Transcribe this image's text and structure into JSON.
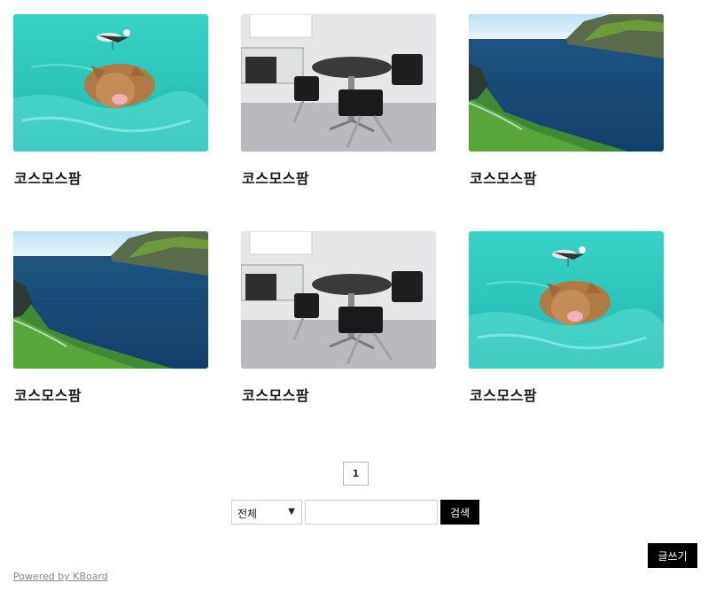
{
  "posts": [
    {
      "title": "코스모스팜",
      "image": "pig-swimming-photo"
    },
    {
      "title": "코스모스팜",
      "image": "office-meeting-room-photo"
    },
    {
      "title": "코스모스팜",
      "image": "sea-cliff-photo"
    },
    {
      "title": "코스모스팜",
      "image": "sea-cliff-photo"
    },
    {
      "title": "코스모스팜",
      "image": "office-meeting-room-photo"
    },
    {
      "title": "코스모스팜",
      "image": "pig-swimming-photo"
    }
  ],
  "pagination": {
    "current_page": "1"
  },
  "search": {
    "category_selected": "전체",
    "caret": "▼",
    "input_value": "",
    "input_placeholder": "",
    "button_label": "검색"
  },
  "write_button_label": "글쓰기",
  "footer": {
    "powered_by": "Powered by KBoard"
  },
  "colors": {
    "button_bg": "#000000",
    "button_text": "#ffffff",
    "link_gray": "#888888"
  }
}
